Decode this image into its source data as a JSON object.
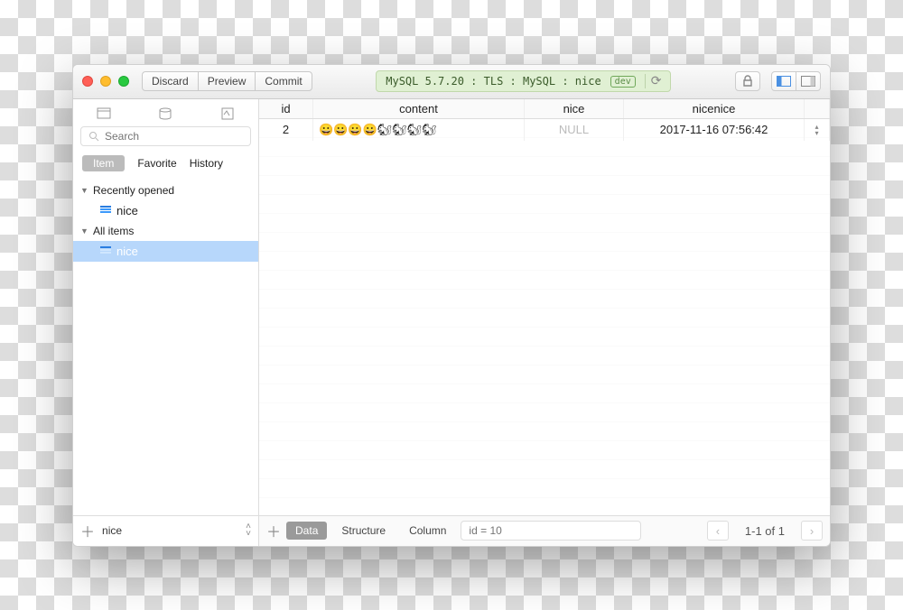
{
  "titlebar": {
    "discard": "Discard",
    "preview": "Preview",
    "commit": "Commit",
    "path": "MySQL 5.7.20 : TLS : MySQL : nice",
    "badge": "dev"
  },
  "sidebar": {
    "search_placeholder": "Search",
    "tabs": {
      "item": "Item",
      "favorite": "Favorite",
      "history": "History"
    },
    "groups": {
      "recent": "Recently opened",
      "all": "All items"
    },
    "recent_items": [
      "nice"
    ],
    "all_items": [
      "nice"
    ],
    "footer_value": "nice"
  },
  "table": {
    "columns": [
      "id",
      "content",
      "nice",
      "nicenice"
    ],
    "rows": [
      {
        "id": "2",
        "content": "😀😀😀😀🐿🐿🐿🐿",
        "nice": "NULL",
        "nicenice": "2017-11-16 07:56:42"
      }
    ]
  },
  "footer": {
    "tabs": {
      "data": "Data",
      "structure": "Structure",
      "column": "Column"
    },
    "filter_placeholder": "id = 10",
    "page_info": "1-1 of 1"
  }
}
